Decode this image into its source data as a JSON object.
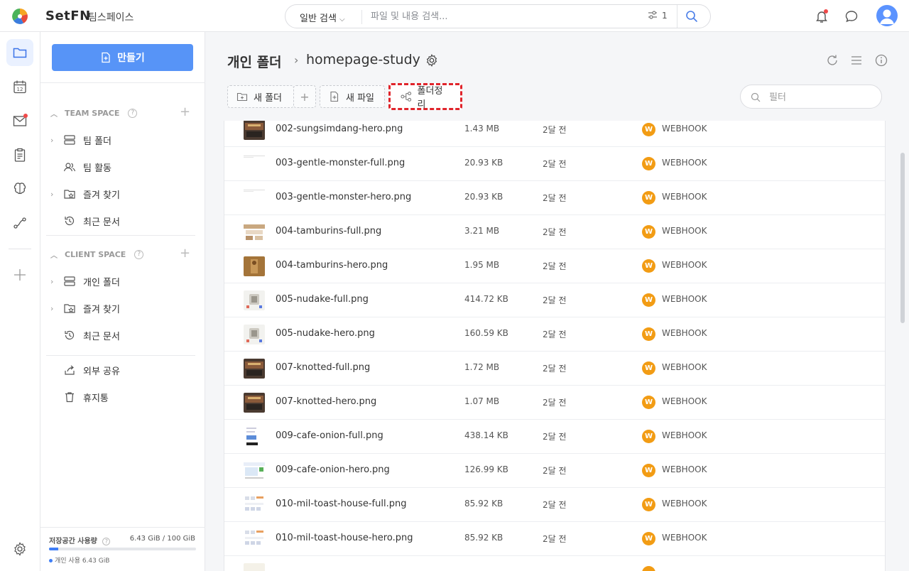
{
  "app": {
    "brand": "SetFN",
    "workspace": "팀스페이스"
  },
  "search": {
    "mode": "일반 검색",
    "placeholder": "파일 및 내용 검색...",
    "filter_count": "1"
  },
  "sidebar": {
    "create_label": "만들기",
    "team_space": {
      "title": "TEAM SPACE",
      "items": [
        {
          "label": "팀 폴더",
          "icon": "server-icon",
          "arrow": true
        },
        {
          "label": "팀 활동",
          "icon": "users-icon",
          "arrow": false
        },
        {
          "label": "즐겨 찾기",
          "icon": "star-folder-icon",
          "arrow": true
        },
        {
          "label": "최근 문서",
          "icon": "history-icon",
          "arrow": false
        }
      ]
    },
    "client_space": {
      "title": "CLIENT SPACE",
      "items": [
        {
          "label": "개인 폴더",
          "icon": "server-icon",
          "arrow": true
        },
        {
          "label": "즐겨 찾기",
          "icon": "star-folder-icon",
          "arrow": true
        },
        {
          "label": "최근 문서",
          "icon": "history-icon",
          "arrow": false
        }
      ]
    },
    "extra_items": [
      {
        "label": "외부 공유",
        "icon": "share-icon"
      },
      {
        "label": "휴지통",
        "icon": "trash-icon"
      }
    ],
    "storage": {
      "label": "저장공간 사용량",
      "value": "6.43 GiB / 100 GiB",
      "personal": "개인 사용 6.43 GiB",
      "used_fraction": 0.0643
    }
  },
  "main": {
    "breadcrumb_root": "개인 폴더",
    "breadcrumb_sep": "›",
    "breadcrumb_current": "homepage-study",
    "toolbar": {
      "new_folder": "새 폴더",
      "add": "+",
      "new_file": "새 파일",
      "organize": "폴더정리"
    },
    "filter_placeholder": "필터"
  },
  "files": [
    {
      "name": "002-sungsimdang-hero.png",
      "size": "1.43 MB",
      "date": "2달 전",
      "owner": "WEBHOOK",
      "owner_initial": "W",
      "thumb": "dark"
    },
    {
      "name": "003-gentle-monster-full.png",
      "size": "20.93 KB",
      "date": "2달 전",
      "owner": "WEBHOOK",
      "owner_initial": "W",
      "thumb": "blank"
    },
    {
      "name": "003-gentle-monster-hero.png",
      "size": "20.93 KB",
      "date": "2달 전",
      "owner": "WEBHOOK",
      "owner_initial": "W",
      "thumb": "blank"
    },
    {
      "name": "004-tamburins-full.png",
      "size": "3.21 MB",
      "date": "2달 전",
      "owner": "WEBHOOK",
      "owner_initial": "W",
      "thumb": "page"
    },
    {
      "name": "004-tamburins-hero.png",
      "size": "1.95 MB",
      "date": "2달 전",
      "owner": "WEBHOOK",
      "owner_initial": "W",
      "thumb": "brown"
    },
    {
      "name": "005-nudake-full.png",
      "size": "414.72 KB",
      "date": "2달 전",
      "owner": "WEBHOOK",
      "owner_initial": "W",
      "thumb": "light"
    },
    {
      "name": "005-nudake-hero.png",
      "size": "160.59 KB",
      "date": "2달 전",
      "owner": "WEBHOOK",
      "owner_initial": "W",
      "thumb": "light"
    },
    {
      "name": "007-knotted-full.png",
      "size": "1.72 MB",
      "date": "2달 전",
      "owner": "WEBHOOK",
      "owner_initial": "W",
      "thumb": "dark"
    },
    {
      "name": "007-knotted-hero.png",
      "size": "1.07 MB",
      "date": "2달 전",
      "owner": "WEBHOOK",
      "owner_initial": "W",
      "thumb": "dark"
    },
    {
      "name": "009-cafe-onion-full.png",
      "size": "438.14 KB",
      "date": "2달 전",
      "owner": "WEBHOOK",
      "owner_initial": "W",
      "thumb": "blue"
    },
    {
      "name": "009-cafe-onion-hero.png",
      "size": "126.99 KB",
      "date": "2달 전",
      "owner": "WEBHOOK",
      "owner_initial": "W",
      "thumb": "bluegreen"
    },
    {
      "name": "010-mil-toast-house-full.png",
      "size": "85.92 KB",
      "date": "2달 전",
      "owner": "WEBHOOK",
      "owner_initial": "W",
      "thumb": "grid"
    },
    {
      "name": "010-mil-toast-house-hero.png",
      "size": "85.92 KB",
      "date": "2달 전",
      "owner": "WEBHOOK",
      "owner_initial": "W",
      "thumb": "grid"
    }
  ],
  "colors": {
    "accent": "#5794f7",
    "owner_badge": "#f29c14",
    "highlight": "#e0242b"
  }
}
